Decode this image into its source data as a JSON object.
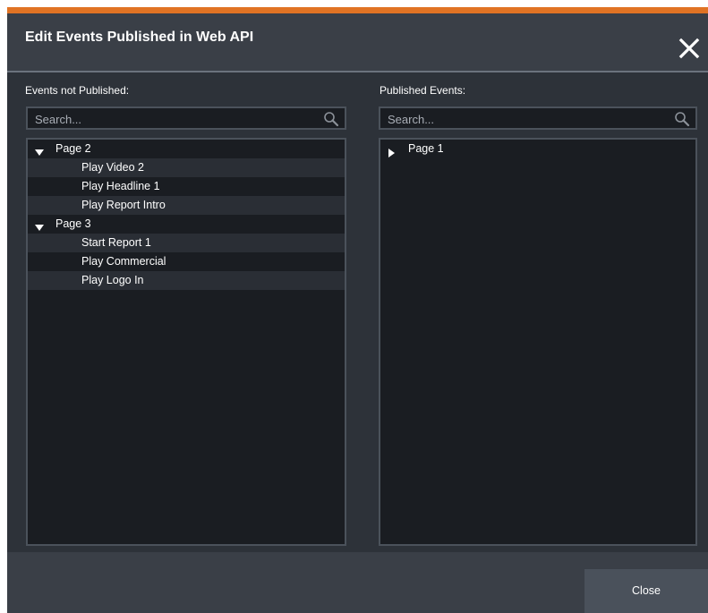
{
  "dialog": {
    "title": "Edit Events Published in Web API",
    "accent_color": "#e07324",
    "close_icon": "close-icon"
  },
  "left_panel": {
    "label": "Events not Published:",
    "search_placeholder": "Search...",
    "search_icon": "search-icon",
    "groups": [
      {
        "label": "Page 2",
        "expanded": true,
        "items": [
          "Play Video 2",
          "Play Headline 1",
          "Play Report Intro"
        ]
      },
      {
        "label": "Page 3",
        "expanded": true,
        "items": [
          "Start Report 1",
          "Play Commercial",
          "Play Logo In"
        ]
      }
    ]
  },
  "right_panel": {
    "label": "Published Events:",
    "search_placeholder": "Search...",
    "search_icon": "search-icon",
    "groups": [
      {
        "label": "Page 1",
        "expanded": false,
        "items": []
      }
    ]
  },
  "footer": {
    "close_label": "Close"
  }
}
